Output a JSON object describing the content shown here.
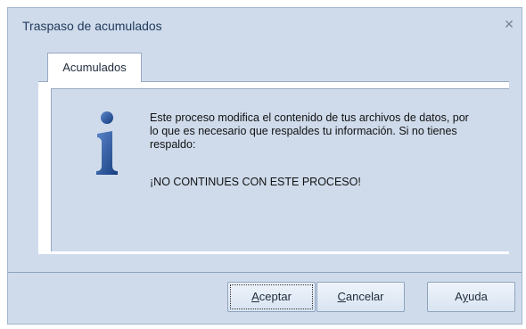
{
  "window": {
    "title": "Traspaso de acumulados",
    "close_icon": "close-icon"
  },
  "tabs": [
    {
      "label": "Acumulados",
      "active": true
    }
  ],
  "message": {
    "icon": "info-icon",
    "text": "Este proceso modifica el contenido de tus archivos de datos, por lo que es necesario que respaldes tu información. Si no tienes respaldo:",
    "warning": "¡NO CONTINUES CON ESTE PROCESO!"
  },
  "buttons": {
    "ok": {
      "mnemonic": "A",
      "rest": "ceptar"
    },
    "cancel": {
      "mnemonic": "C",
      "rest": "ancelar"
    },
    "help": {
      "pre": "A",
      "mnemonic": "y",
      "rest": "uda"
    }
  },
  "colors": {
    "background": "#cfdbeb",
    "border": "#97a9c1",
    "icon_blue": "#1f4f9c"
  }
}
